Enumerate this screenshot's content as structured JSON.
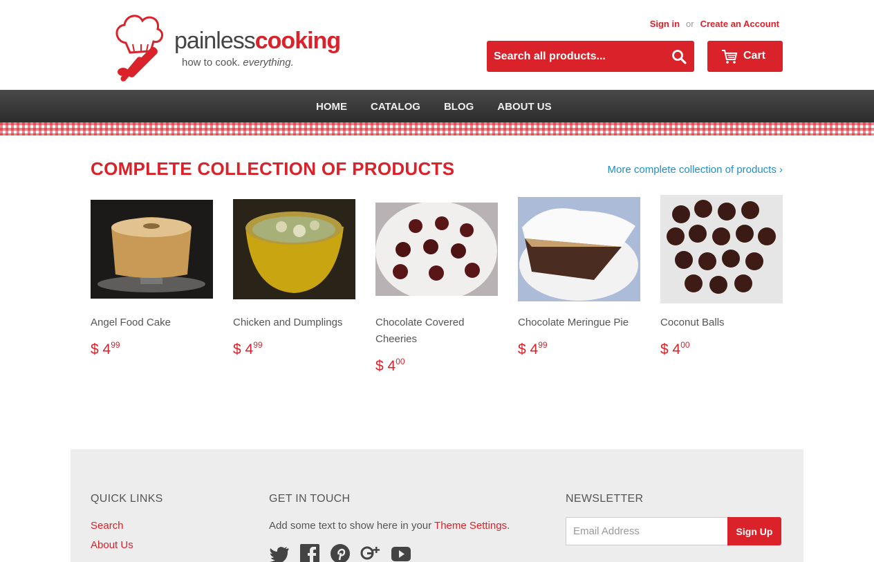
{
  "header": {
    "logo": {
      "word1": "painless",
      "word2": "cooking",
      "tagline_plain": "how to cook. ",
      "tagline_italic": "everything."
    },
    "account": {
      "sign_in": "Sign in",
      "or": "or",
      "create": "Create an Account"
    },
    "search": {
      "placeholder": "Search all products..."
    },
    "cart_label": "Cart"
  },
  "nav": {
    "items": [
      "HOME",
      "CATALOG",
      "BLOG",
      "ABOUT US"
    ]
  },
  "main": {
    "title": "COMPLETE COLLECTION OF PRODUCTS",
    "more_link": "More complete collection of products ›",
    "products": [
      {
        "name": "Angel Food Cake",
        "price_main": "$ 4",
        "price_cents": "99"
      },
      {
        "name": "Chicken and Dumplings",
        "price_main": "$ 4",
        "price_cents": "99"
      },
      {
        "name": "Chocolate Covered Cheeries",
        "price_main": "$ 4",
        "price_cents": "00"
      },
      {
        "name": "Chocolate Meringue Pie",
        "price_main": "$ 4",
        "price_cents": "99"
      },
      {
        "name": "Coconut Balls",
        "price_main": "$ 4",
        "price_cents": "00"
      }
    ]
  },
  "footer": {
    "quick_links": {
      "heading": "QUICK LINKS",
      "items": [
        "Search",
        "About Us"
      ]
    },
    "get_in_touch": {
      "heading": "GET IN TOUCH",
      "text": "Add some text to show here in your ",
      "link": "Theme Settings",
      "after": "."
    },
    "newsletter": {
      "heading": "NEWSLETTER",
      "placeholder": "Email Address",
      "button": "Sign Up"
    }
  },
  "colors": {
    "brand": "#d9222a",
    "link": "#1e8fc6",
    "nav_bg": "#333333"
  },
  "icons": [
    "chef-hat-logo-icon",
    "search-icon",
    "cart-icon",
    "twitter-icon",
    "facebook-icon",
    "pinterest-icon",
    "google-plus-icon",
    "youtube-icon"
  ]
}
